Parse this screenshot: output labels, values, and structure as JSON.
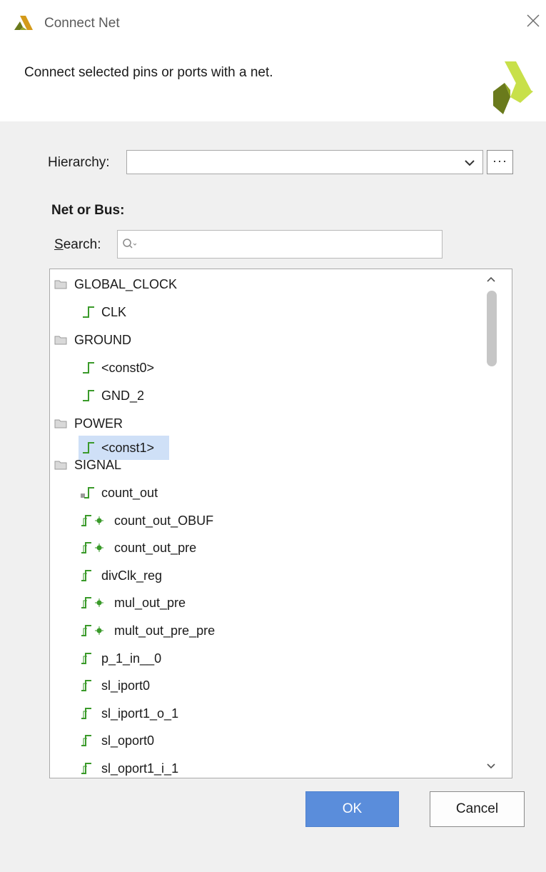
{
  "window": {
    "title": "Connect Net",
    "close_icon": "close-icon",
    "logo_icon": "vivado-logo-icon"
  },
  "header": {
    "description": "Connect selected pins or ports with a net.",
    "logo_icon": "vivado-logo-icon"
  },
  "hierarchy": {
    "label": "Hierarchy:",
    "value": "",
    "browse_label": "···"
  },
  "net_or_bus": {
    "heading": "Net or Bus:"
  },
  "search": {
    "label_first": "S",
    "label_rest": "earch:",
    "placeholder": "",
    "icon": "search-icon"
  },
  "tree": {
    "groups": [
      {
        "name": "GLOBAL_CLOCK",
        "items": [
          {
            "label": "CLK",
            "icon": "net-icon"
          }
        ]
      },
      {
        "name": "GROUND",
        "items": [
          {
            "label": "<const0>",
            "icon": "net-icon"
          },
          {
            "label": "GND_2",
            "icon": "net-icon"
          }
        ]
      },
      {
        "name": "POWER",
        "items": [
          {
            "label": "<const1>",
            "icon": "net-icon",
            "selected": true
          }
        ]
      },
      {
        "name": "SIGNAL",
        "items": [
          {
            "label": "count_out",
            "icon": "bus-net-icon"
          },
          {
            "label": "count_out_OBUF",
            "icon": "net-debug-icon"
          },
          {
            "label": "count_out_pre",
            "icon": "net-debug-icon"
          },
          {
            "label": "divClk_reg",
            "icon": "net-icon"
          },
          {
            "label": "mul_out_pre",
            "icon": "net-debug-icon"
          },
          {
            "label": "mult_out_pre_pre",
            "icon": "net-debug-icon"
          },
          {
            "label": "p_1_in__0",
            "icon": "net-icon"
          },
          {
            "label": "sl_iport0",
            "icon": "net-icon"
          },
          {
            "label": "sl_iport1_o_1",
            "icon": "net-icon"
          },
          {
            "label": "sl_oport0",
            "icon": "net-icon"
          },
          {
            "label": "sl_oport1_i_1",
            "icon": "net-icon"
          }
        ]
      }
    ]
  },
  "buttons": {
    "ok": "OK",
    "cancel": "Cancel"
  },
  "colors": {
    "accent": "#5a8ddb",
    "selection": "#cfe0f7",
    "net_green": "#3a9a2a",
    "logo_dark": "#6a7a1c",
    "logo_light": "#c8e04a"
  }
}
